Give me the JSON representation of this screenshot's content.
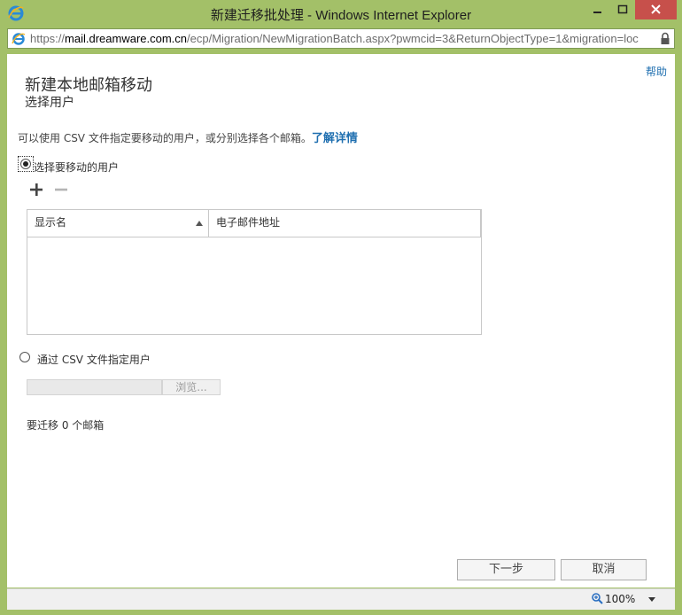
{
  "window": {
    "title": "新建迁移批处理 - Windows Internet Explorer"
  },
  "address_bar": {
    "url_prefix": "https://",
    "url_host": "mail.dreamware.com.cn",
    "url_rest": "/ecp/Migration/NewMigrationBatch.aspx?pwmcid=3&ReturnObjectType=1&migration=loc"
  },
  "page": {
    "help_link": "帮助",
    "title": "新建本地邮箱移动",
    "subtitle": "选择用户",
    "intro_text": "可以使用 CSV 文件指定要移动的用户，或分别选择各个邮箱。",
    "learn_more_link": "了解详情",
    "option_select_users": "选择要移动的用户",
    "option_csv": "通过 CSV 文件指定用户",
    "grid": {
      "columns": [
        "显示名",
        "电子邮件地址"
      ],
      "rows": []
    },
    "browse_button": "浏览...",
    "mailbox_count_text": "要迁移 0 个邮箱",
    "next_button": "下一步",
    "cancel_button": "取消"
  },
  "status_bar": {
    "zoom": "100%"
  },
  "colors": {
    "frame": "#a3c068",
    "link": "#1f6fb0",
    "close_button": "#c7504b"
  }
}
